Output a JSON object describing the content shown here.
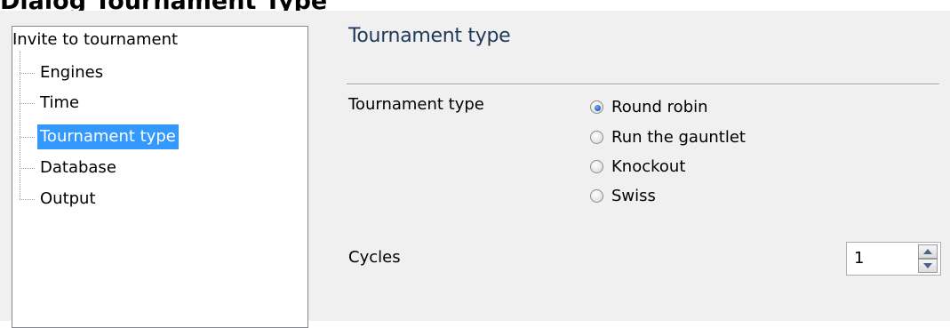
{
  "window": {
    "title": "Dialog Tournament Type"
  },
  "tree": {
    "root_label": "Invite to tournament",
    "items": [
      {
        "label": "Engines",
        "selected": false
      },
      {
        "label": "Time",
        "selected": false
      },
      {
        "label": "Tournament type",
        "selected": true
      },
      {
        "label": "Database",
        "selected": false
      },
      {
        "label": "Output",
        "selected": false
      }
    ]
  },
  "section": {
    "title": "Tournament type"
  },
  "tournament_type": {
    "label": "Tournament type",
    "options": [
      {
        "label": "Round robin",
        "checked": true
      },
      {
        "label": "Run the gauntlet",
        "checked": false
      },
      {
        "label": "Knockout",
        "checked": false
      },
      {
        "label": "Swiss",
        "checked": false
      }
    ]
  },
  "cycles": {
    "label": "Cycles",
    "value": "1"
  },
  "colors": {
    "selection": "#3399ff",
    "dialog_background": "#f0f0f0",
    "section_title": "#1e395b"
  },
  "icons": {
    "radio_checked": "radio-checked-icon",
    "radio_unchecked": "radio-unchecked-icon",
    "spin_up": "arrow-up-icon",
    "spin_down": "arrow-down-icon"
  }
}
